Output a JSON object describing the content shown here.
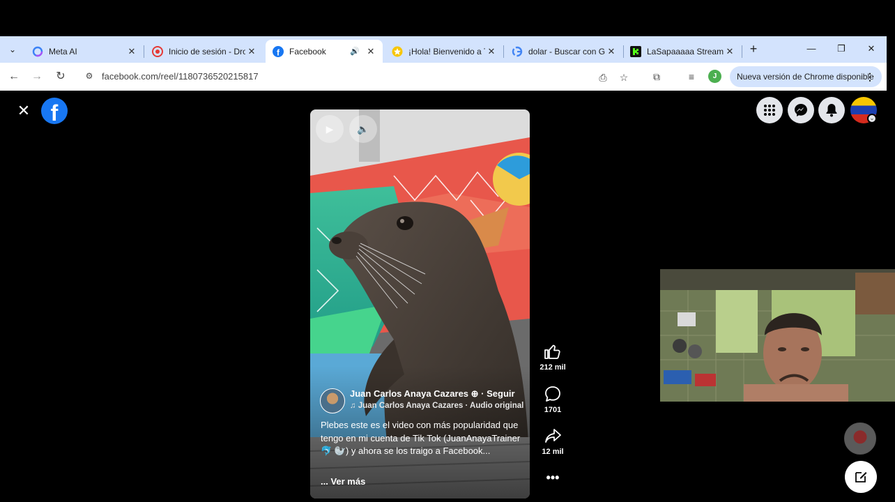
{
  "browser": {
    "tabs": [
      {
        "title": "Meta AI",
        "icon": "meta-ai-icon"
      },
      {
        "title": "Inicio de sesión - Dro",
        "icon": "dropout-icon"
      },
      {
        "title": "Facebook",
        "icon": "facebook-icon",
        "active": true
      },
      {
        "title": "¡Hola! Bienvenido a T",
        "icon": "star-icon"
      },
      {
        "title": "dolar - Buscar con Go",
        "icon": "google-icon"
      },
      {
        "title": "LaSapaaaaa Stream -",
        "icon": "kick-icon"
      }
    ],
    "url": "facebook.com/reel/1180736520215817",
    "profile_initial": "J",
    "update_label": "Nueva versión de Chrome disponible"
  },
  "reel": {
    "author": "Juan Carlos Anaya Cazares",
    "follow_label": "Seguir",
    "audio": "Juan Carlos Anaya Cazares · Audio original",
    "caption": "Plebes este es el video con más popularidad que tengo en mi cuenta de Tik Tok (JuanAnayaTrainer 🐬 🦭) y ahora se los traigo a Facebook...",
    "see_more": "... Ver más"
  },
  "actions": {
    "likes": "212 mil",
    "comments": "1701",
    "shares": "12 mil"
  },
  "colors": {
    "facebook_blue": "#1877f2",
    "tabstrip": "#d3e3fd"
  }
}
